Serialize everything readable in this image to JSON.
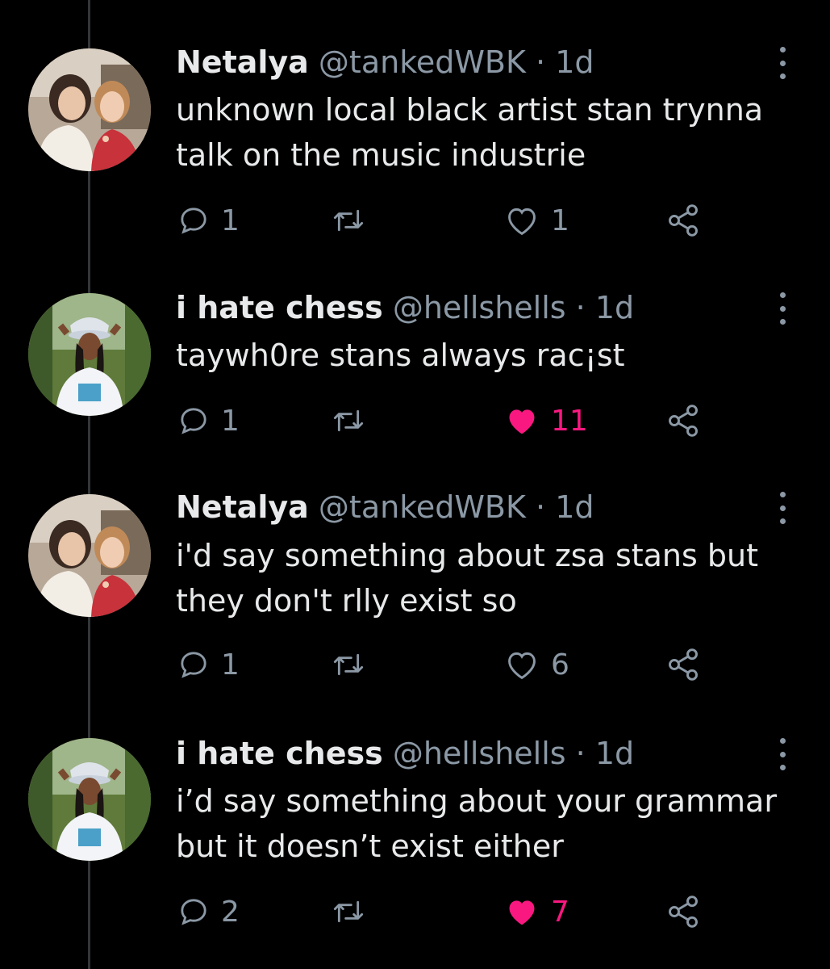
{
  "tweets": [
    {
      "name": "Netalya",
      "handle": "@tankedWBK",
      "separator": "·",
      "time": "1d",
      "text": "unknown local black artist stan trynna talk on the music industrie",
      "replies": "1",
      "likes": "1",
      "liked": false,
      "avatar": "photo-two-women-icon"
    },
    {
      "name": "i hate chess",
      "handle": "@hellshells",
      "separator": "·",
      "time": "1d",
      "text": "taywh0re stans always rac¡st",
      "replies": "1",
      "likes": "11",
      "liked": true,
      "avatar": "photo-person-bucket-hat-icon"
    },
    {
      "name": "Netalya",
      "handle": "@tankedWBK",
      "separator": "·",
      "time": "1d",
      "text": "i'd say something about zsa stans but they don't rlly exist so",
      "replies": "1",
      "likes": "6",
      "liked": false,
      "avatar": "photo-two-women-icon"
    },
    {
      "name": "i hate chess",
      "handle": "@hellshells",
      "separator": "·",
      "time": "1d",
      "text": "i’d say something about your grammar but it doesn’t exist either",
      "replies": "2",
      "likes": "7",
      "liked": true,
      "avatar": "photo-person-bucket-hat-icon"
    }
  ],
  "colors": {
    "background": "#000000",
    "text": "#e7e9ea",
    "secondary": "#8b98a5",
    "like_active": "#f91880",
    "thread_line": "#333639"
  }
}
